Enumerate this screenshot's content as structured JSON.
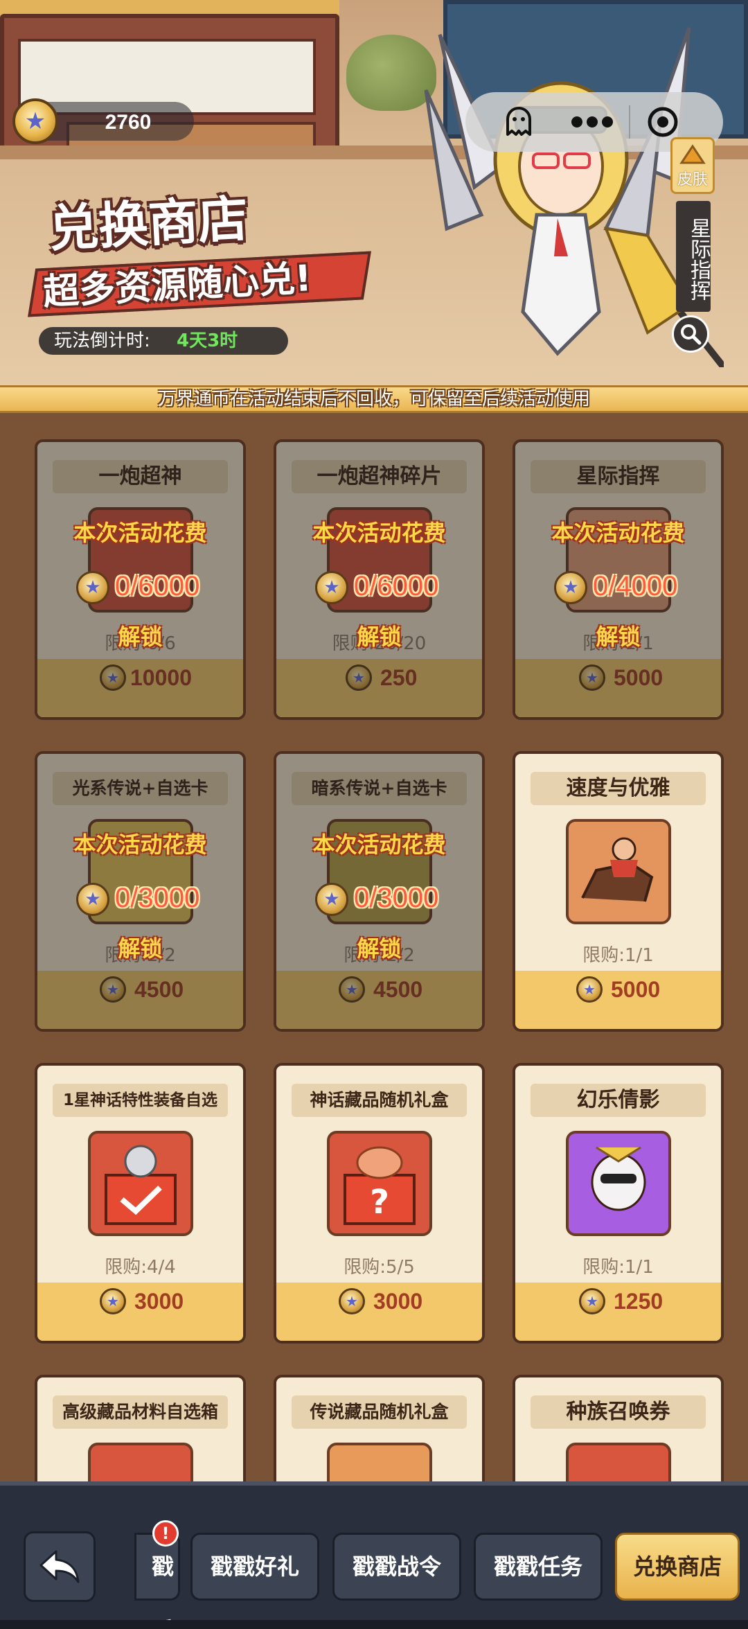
{
  "header": {
    "coin_balance": "2760",
    "title": "兑换商店",
    "subtitle": "超多资源随心兑!",
    "countdown_label": "玩法倒计时:",
    "countdown_value": "4天3时",
    "skin_tag": "皮肤",
    "character_name": "星际指挥"
  },
  "notice": "万界通币在活动结束后不回收，可保留至后续活动使用",
  "lock_labels": {
    "spend_line": "本次活动花费",
    "unlock": "解锁"
  },
  "items": [
    {
      "name": "一炮超神",
      "limit": "限购:6/6",
      "price": "10000",
      "locked": true,
      "progress": "0/6000",
      "icon": "mech-icon"
    },
    {
      "name": "一炮超神碎片",
      "limit": "限购:20/20",
      "price": "250",
      "locked": true,
      "progress": "0/6000",
      "icon": "mech-shard-icon"
    },
    {
      "name": "星际指挥",
      "limit": "限购:1/1",
      "price": "5000",
      "locked": true,
      "progress": "0/4000",
      "icon": "commander-skin-icon"
    },
    {
      "name": "光系传说+自选卡",
      "limit": "限购:2/2",
      "price": "4500",
      "locked": true,
      "progress": "0/3000",
      "icon": "light-card-icon"
    },
    {
      "name": "暗系传说+自选卡",
      "limit": "限购:2/2",
      "price": "4500",
      "locked": true,
      "progress": "0/3000",
      "icon": "dark-card-icon"
    },
    {
      "name": "速度与优雅",
      "limit": "限购:1/1",
      "price": "5000",
      "locked": false,
      "progress": "",
      "icon": "horse-rider-icon"
    },
    {
      "name": "1星神话特性装备自选",
      "limit": "限购:4/4",
      "price": "3000",
      "locked": false,
      "progress": "",
      "icon": "gear-box-icon"
    },
    {
      "name": "神话藏品随机礼盒",
      "limit": "限购:5/5",
      "price": "3000",
      "locked": false,
      "progress": "",
      "icon": "mystery-box-icon"
    },
    {
      "name": "幻乐倩影",
      "limit": "限购:1/1",
      "price": "1250",
      "locked": false,
      "progress": "",
      "icon": "idol-skin-icon"
    },
    {
      "name": "高级藏品材料自选箱",
      "limit": "",
      "price": "",
      "locked": false,
      "progress": "",
      "icon": "crystal-icon"
    },
    {
      "name": "传说藏品随机礼盒",
      "limit": "",
      "price": "",
      "locked": false,
      "progress": "",
      "icon": "gold-box-icon"
    },
    {
      "name": "种族召唤券",
      "limit": "",
      "price": "",
      "locked": false,
      "progress": "",
      "icon": "ticket-icon"
    }
  ],
  "nav": {
    "partial_tab": "戳乐",
    "badge": "!",
    "tabs": [
      "戳戳好礼",
      "戳戳战令",
      "戳戳任务",
      "兑换商店"
    ],
    "active": "兑换商店"
  },
  "colors": {
    "accent_gold": "#f3c86a",
    "price_red": "#a23d24",
    "progress_red": "#ff5a3c",
    "countdown_green": "#6ee85a",
    "nav_bg": "#2a2f3d"
  }
}
